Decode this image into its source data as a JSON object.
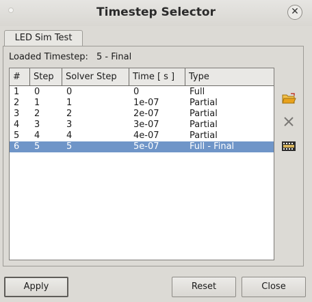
{
  "window": {
    "title": "Timestep Selector",
    "close_glyph": "✕"
  },
  "tab": {
    "label": "LED Sim Test"
  },
  "loaded": {
    "label": "Loaded Timestep:",
    "value": "5 - Final"
  },
  "table": {
    "columns": [
      "#",
      "Step",
      "Solver Step",
      "Time [ s ]",
      "Type"
    ],
    "rows": [
      [
        "1",
        "0",
        "0",
        "0",
        "Full"
      ],
      [
        "2",
        "1",
        "1",
        "1e-07",
        "Partial"
      ],
      [
        "3",
        "2",
        "2",
        "2e-07",
        "Partial"
      ],
      [
        "4",
        "3",
        "3",
        "3e-07",
        "Partial"
      ],
      [
        "5",
        "4",
        "4",
        "4e-07",
        "Partial"
      ],
      [
        "6",
        "5",
        "5",
        "5e-07",
        "Full - Final"
      ]
    ],
    "selected_row": 6
  },
  "side_icons": [
    "folder-open-icon",
    "delete-icon",
    "film-icon"
  ],
  "buttons": {
    "apply": "Apply",
    "reset": "Reset",
    "close": "Close"
  },
  "colors": {
    "selection": "#6f95c8",
    "folder": "#e8a21c"
  }
}
